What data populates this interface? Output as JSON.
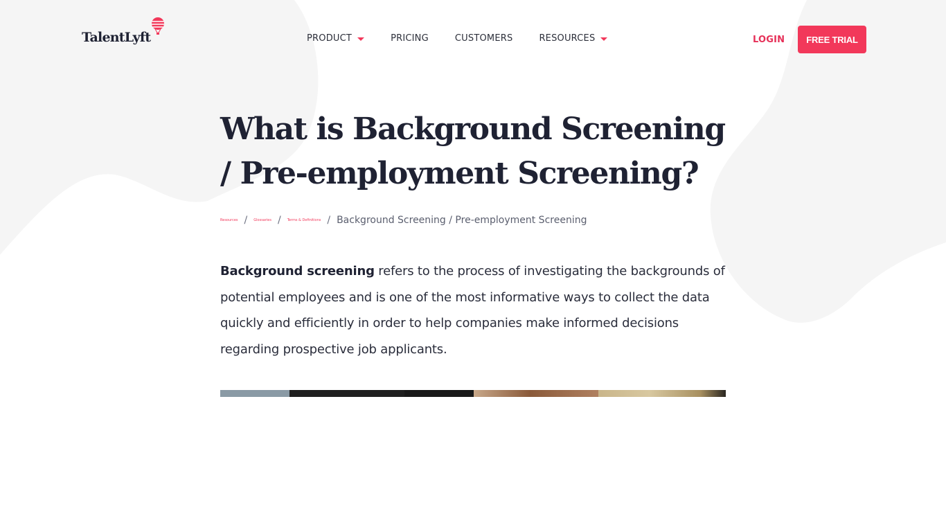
{
  "brand": {
    "name": "TalentLyft",
    "accent_color": "#f2385a",
    "text_color": "#1f2233",
    "background_shape_color": "#f5f5f5"
  },
  "nav": {
    "items": [
      {
        "label": "PRODUCT",
        "has_dropdown": true
      },
      {
        "label": "PRICING",
        "has_dropdown": false
      },
      {
        "label": "CUSTOMERS",
        "has_dropdown": false
      },
      {
        "label": "RESOURCES",
        "has_dropdown": true
      }
    ],
    "login_label": "LOGIN",
    "free_trial_label": "FREE TRIAL"
  },
  "page": {
    "title": "What is Background Screening / Pre-employment Screening?",
    "breadcrumb": {
      "links": [
        "Resources",
        "Glossaries",
        "Terms & Definitions"
      ],
      "separator": "/",
      "current": "Background Screening / Pre-employment Screening"
    },
    "intro": {
      "bold_lead": "Background screening",
      "rest": " refers to the process of investigating the backgrounds of potential employees and is one of the most informative ways to collect the data quickly and efficiently in order to help companies make informed decisions regarding prospective job applicants."
    },
    "hero_image_alt": "Background screening"
  }
}
